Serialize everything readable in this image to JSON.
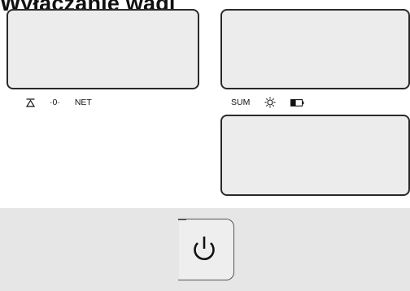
{
  "title": "Wyłączanie wagi",
  "indicators_left": [
    {
      "icon": "tare-triangle-icon"
    },
    {
      "label": "·0·"
    },
    {
      "label": "NET"
    }
  ],
  "indicators_right": [
    {
      "label": "SUM"
    },
    {
      "icon": "sun-backlight-icon"
    },
    {
      "icon": "battery-icon"
    }
  ],
  "power_button": {
    "icon": "power-icon"
  },
  "colors": {
    "display_fill": "#ececec",
    "display_border": "#2a2a2a",
    "panel_fill": "#e6e6e6"
  }
}
